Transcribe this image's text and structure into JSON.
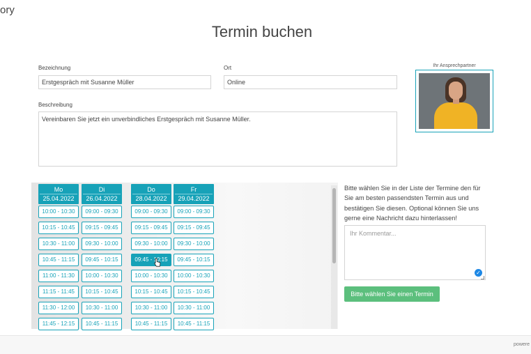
{
  "corner_text": "ory",
  "title": "Termin buchen",
  "fields": {
    "bezeichnung": {
      "label": "Bezeichnung",
      "value": "Erstgespräch mit Susanne Müller"
    },
    "ort": {
      "label": "Ort",
      "value": "Online"
    },
    "beschreibung": {
      "label": "Beschreibung",
      "value": "Vereinbaren Sie jetzt ein unverbindliches Erstgespräch mit Susanne Müller."
    }
  },
  "contact": {
    "label": "Ihr Ansprechpartner"
  },
  "days": [
    {
      "name": "Mo",
      "date": "25.04.2022",
      "slots": [
        "10:00 - 10:30",
        "10:15 - 10:45",
        "10:30 - 11:00",
        "10:45 - 11:15",
        "11:00 - 11:30",
        "11:15 - 11:45",
        "11:30 - 12:00",
        "11:45 - 12:15"
      ]
    },
    {
      "name": "Di",
      "date": "26.04.2022",
      "slots": [
        "09:00 - 09:30",
        "09:15 - 09:45",
        "09:30 - 10:00",
        "09:45 - 10:15",
        "10:00 - 10:30",
        "10:15 - 10:45",
        "10:30 - 11:00",
        "10:45 - 11:15"
      ]
    },
    {
      "name": "Do",
      "date": "28.04.2022",
      "slots": [
        "09:00 - 09:30",
        "09:15 - 09:45",
        "09:30 - 10:00",
        "09:45 - 10:15",
        "10:00 - 10:30",
        "10:15 - 10:45",
        "10:30 - 11:00",
        "10:45 - 11:15"
      ]
    },
    {
      "name": "Fr",
      "date": "29.04.2022",
      "slots": [
        "09:00 - 09:30",
        "09:15 - 09:45",
        "09:30 - 10:00",
        "09:45 - 10:15",
        "10:00 - 10:30",
        "10:15 - 10:45",
        "10:30 - 11:00",
        "10:45 - 11:15"
      ]
    }
  ],
  "selected_slot": {
    "day": 2,
    "slot": 3
  },
  "instructions": "Bitte wählen Sie in der Liste der Termine den für Sie am besten passendsten Termin aus und bestätigen Sie diesen. Optional können Sie uns gerne eine Nachricht dazu hinterlassen!",
  "comment": {
    "placeholder": "Ihr Kommentar..."
  },
  "submit_label": "Bitte wählen Sie einen Termin",
  "footer_text": "powere",
  "colors": {
    "accent": "#17a2b8",
    "submit": "#5cbf7d",
    "check": "#1e88e5"
  },
  "icons": {
    "cursor": "hand-pointer-icon",
    "check": "check-circle-icon",
    "resize": "resize-grip-icon"
  }
}
